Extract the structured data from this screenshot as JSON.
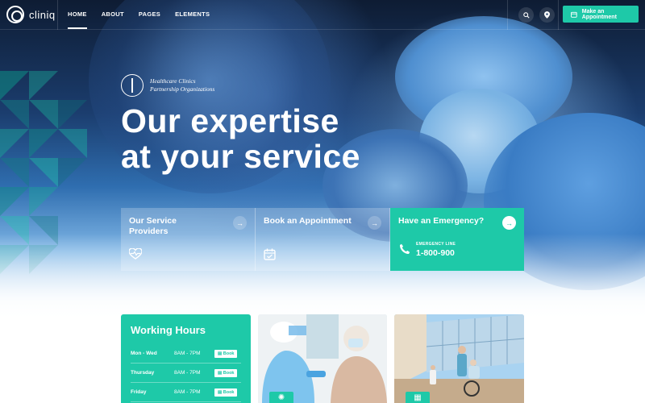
{
  "brand": {
    "name": "cliniq"
  },
  "nav": {
    "items": [
      {
        "label": "HOME",
        "active": true
      },
      {
        "label": "ABOUT",
        "active": false
      },
      {
        "label": "PAGES",
        "active": false
      },
      {
        "label": "ELEMENTS",
        "active": false
      }
    ],
    "cta_label": "Make an Appointment",
    "icons": [
      "search-icon",
      "location-pin-icon",
      "calendar-icon"
    ]
  },
  "hero": {
    "badge_line1": "Healthcare Clinics",
    "badge_line2": "Partnership Organizations",
    "headline_line1": "Our expertise",
    "headline_line2": "at your service"
  },
  "cards": [
    {
      "title": "Our Service Providers",
      "icon": "heart-pulse-icon"
    },
    {
      "title": "Book an Appointment",
      "icon": "calendar-icon"
    },
    {
      "title": "Have an Emergency?",
      "line_label": "EMERGENCY LINE",
      "phone": "1-800-900",
      "icon": "phone-icon"
    }
  ],
  "working_hours": {
    "title": "Working Hours",
    "rows": [
      {
        "day": "Mon - Wed",
        "time": "8AM - 7PM",
        "action": "Book"
      },
      {
        "day": "Thursday",
        "time": "8AM - 7PM",
        "action": "Book"
      },
      {
        "day": "Friday",
        "time": "8AM - 7PM",
        "action": "Book"
      }
    ]
  },
  "colors": {
    "accent": "#1ec9a8",
    "nav_bg": "#0e1c33",
    "hero_blue": "#2f6eb0"
  }
}
